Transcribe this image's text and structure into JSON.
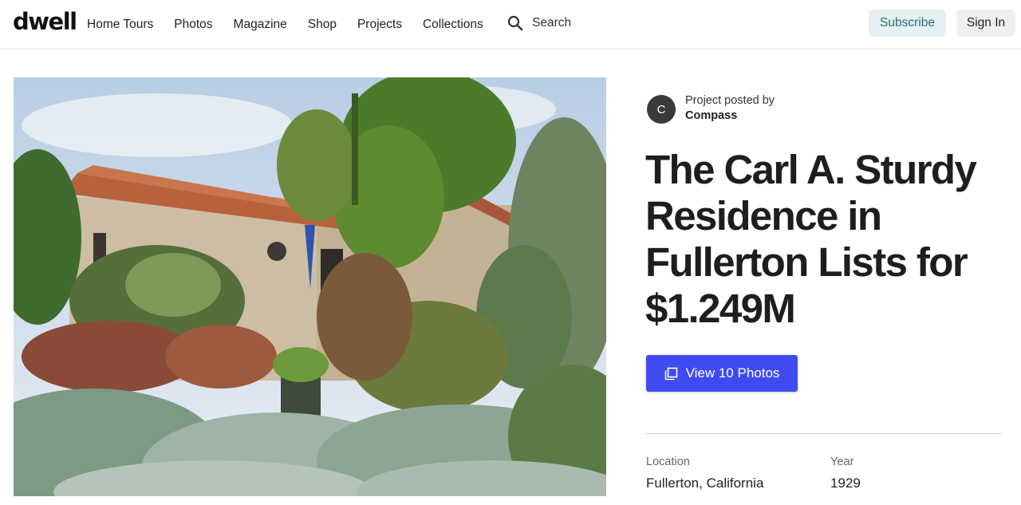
{
  "header": {
    "logo": "dwell",
    "nav": [
      "Home Tours",
      "Photos",
      "Magazine",
      "Shop",
      "Projects",
      "Collections"
    ],
    "search_label": "Search",
    "search_icon": "search-icon",
    "subscribe_label": "Subscribe",
    "signin_label": "Sign In",
    "colors": {
      "subscribe_bg": "#e4f0f1",
      "subscribe_text": "#2d6e7b",
      "signin_bg": "#efefef"
    }
  },
  "hero": {
    "alt": "Spanish-style house with red tile roof surrounded by lush garden"
  },
  "poster": {
    "avatar_initial": "C",
    "label": "Project posted by",
    "name": "Compass"
  },
  "article": {
    "title": "The Carl A. Sturdy Residence in Fullerton Lists for $1.249M",
    "photos_button_label": "View 10 Photos",
    "photos_icon": "photo-stack-icon",
    "accent_color": "#3f4bf0"
  },
  "details": {
    "location_label": "Location",
    "location_value": "Fullerton, California",
    "year_label": "Year",
    "year_value": "1929"
  }
}
